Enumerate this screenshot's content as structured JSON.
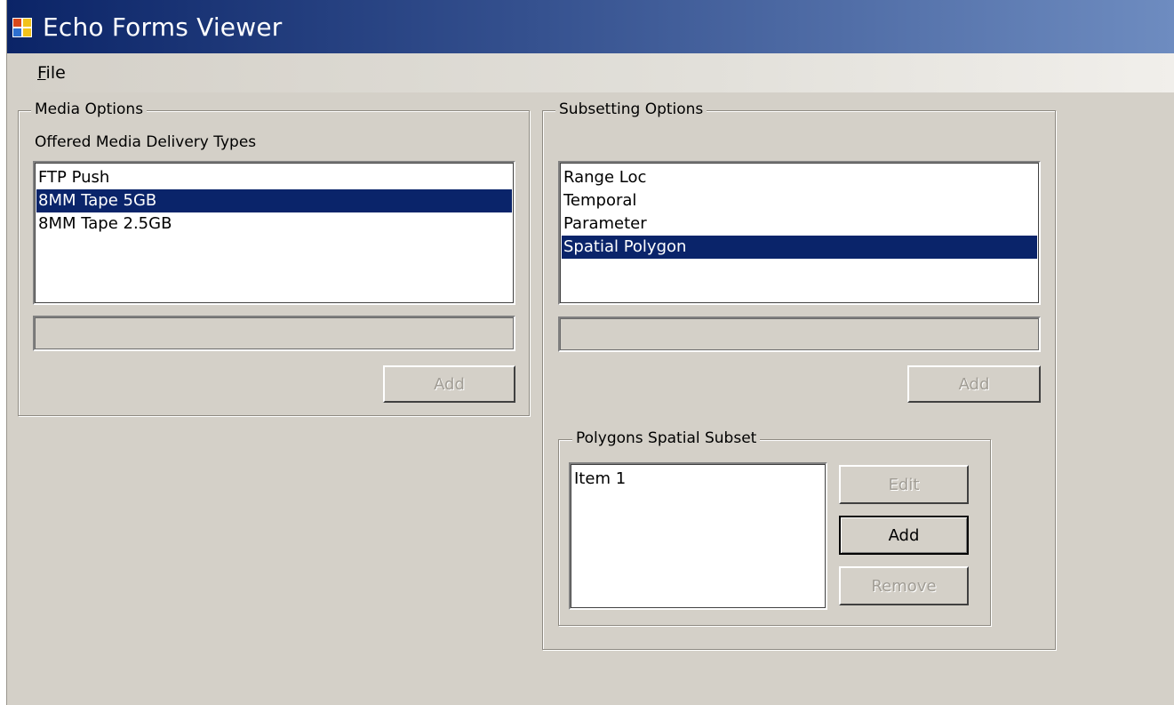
{
  "window": {
    "title": "Echo Forms Viewer",
    "icon": "app-grid-icon"
  },
  "menu": {
    "items": [
      {
        "label_mnemonic": "F",
        "label_rest": "ile"
      }
    ]
  },
  "media": {
    "group_title": "Media Options",
    "list_label": "Offered Media Delivery Types",
    "items": [
      "FTP Push",
      "8MM Tape 5GB",
      "8MM Tape 2.5GB"
    ],
    "selected_index": 1,
    "input_value": "",
    "add_label": "Add"
  },
  "subset": {
    "group_title": "Subsetting Options",
    "items": [
      "Range Loc",
      "Temporal",
      "Parameter",
      "Spatial Polygon"
    ],
    "selected_index": 3,
    "input_value": "",
    "add_label": "Add"
  },
  "polygons": {
    "group_title": "Polygons Spatial Subset",
    "items": [
      "Item 1"
    ],
    "edit_label": "Edit",
    "add_label": "Add",
    "remove_label": "Remove"
  },
  "colors": {
    "selection": "#0a246a",
    "window_bg": "#d4d0c8",
    "title_start": "#0b2467",
    "title_end": "#6e8cc0"
  }
}
